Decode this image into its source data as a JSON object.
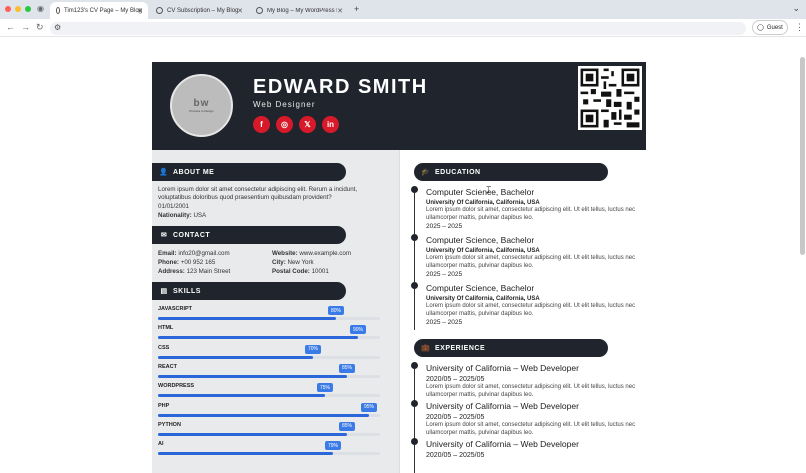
{
  "browser": {
    "tabs": [
      {
        "title": "Tim123's CV Page – My Blog",
        "active": true
      },
      {
        "title": "CV Subscription – My Blog",
        "active": false
      },
      {
        "title": "My Blog – My WordPress Blo",
        "active": false
      }
    ],
    "new_tab": "+",
    "profile_label": "Guest"
  },
  "cv": {
    "name": "EDWARD SMITH",
    "role": "Web Designer",
    "avatar_text": "bw",
    "avatar_subtext": "Process to Design",
    "socials": [
      {
        "icon": "facebook-icon",
        "glyph": "f"
      },
      {
        "icon": "instagram-icon",
        "glyph": "◎"
      },
      {
        "icon": "x-icon",
        "glyph": "𝕏"
      },
      {
        "icon": "linkedin-icon",
        "glyph": "in"
      }
    ],
    "about": {
      "heading": "ABOUT ME",
      "text": "Lorem ipsum dolor sit amet consectetur adipiscing elit. Rerum a incidunt, voluptatibus doloribus quod praesentium quibusdam provident?",
      "dob": "01/01/2001",
      "nationality_label": "Nationality:",
      "nationality": "USA"
    },
    "contact": {
      "heading": "CONTACT",
      "email_label": "Email:",
      "email": "info20@gmail.com",
      "phone_label": "Phone:",
      "phone": "+00 952 165",
      "address_label": "Address:",
      "address": "123 Main Street",
      "website_label": "Website:",
      "website": "www.example.com",
      "city_label": "City:",
      "city": "New York",
      "postal_label": "Postal Code:",
      "postal": "10001"
    },
    "skills": {
      "heading": "SKILLS",
      "items": [
        {
          "name": "JAVASCRIPT",
          "pct_label": "80%",
          "value": 0.8
        },
        {
          "name": "HTML",
          "pct_label": "90%",
          "value": 0.9
        },
        {
          "name": "CSS",
          "pct_label": "70%",
          "value": 0.7
        },
        {
          "name": "REACT",
          "pct_label": "85%",
          "value": 0.85
        },
        {
          "name": "WORDPRESS",
          "pct_label": "75%",
          "value": 0.75
        },
        {
          "name": "PHP",
          "pct_label": "95%",
          "value": 0.95
        },
        {
          "name": "PYTHON",
          "pct_label": "85%",
          "value": 0.85
        },
        {
          "name": "AI",
          "pct_label": "79%",
          "value": 0.79
        }
      ]
    },
    "education": {
      "heading": "EDUCATION",
      "items": [
        {
          "title": "Computer Science, Bachelor",
          "school": "University Of California, California, USA",
          "desc": "Lorem ipsum dolor sit amet, consectetur adipiscing elit. Ut elit tellus, luctus nec ullamcorper mattis, pulvinar dapibus leo.",
          "dates": "2025 – 2025"
        },
        {
          "title": "Computer Science, Bachelor",
          "school": "University Of California, California, USA",
          "desc": "Lorem ipsum dolor sit amet, consectetur adipiscing elit. Ut elit tellus, luctus nec ullamcorper mattis, pulvinar dapibus leo.",
          "dates": "2025 – 2025"
        },
        {
          "title": "Computer Science, Bachelor",
          "school": "University Of California, California, USA",
          "desc": "Lorem ipsum dolor sit amet, consectetur adipiscing elit. Ut elit tellus, luctus nec ullamcorper mattis, pulvinar dapibus leo.",
          "dates": "2025 – 2025"
        }
      ]
    },
    "experience": {
      "heading": "EXPERIENCE",
      "items": [
        {
          "title": "University of California – Web Developer",
          "dates": "2020/05 – 2025/05",
          "desc": "Lorem ipsum dolor sit amet, consectetur adipiscing elit. Ut elit tellus, luctus nec ullamcorper mattis, pulvinar dapibus leo."
        },
        {
          "title": "University of California – Web Developer",
          "dates": "2020/05 – 2025/05",
          "desc": "Lorem ipsum dolor sit amet, consectetur adipiscing elit. Ut elit tellus, luctus nec ullamcorper mattis, pulvinar dapibus leo."
        },
        {
          "title": "University of California – Web Developer",
          "dates": "2020/05 – 2025/05",
          "desc": ""
        }
      ]
    }
  },
  "colors": {
    "dark": "#1f242d",
    "accent_red": "#d7192a",
    "bar_blue": "#2b67d8"
  }
}
